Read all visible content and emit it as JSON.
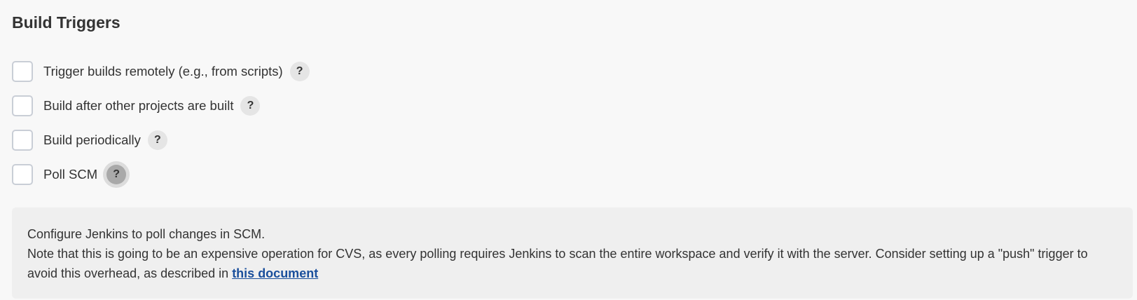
{
  "section": {
    "title": "Build Triggers"
  },
  "triggers": [
    {
      "label": "Trigger builds remotely (e.g., from scripts)",
      "checked": false,
      "help_label": "?"
    },
    {
      "label": "Build after other projects are built",
      "checked": false,
      "help_label": "?"
    },
    {
      "label": "Build periodically",
      "checked": false,
      "help_label": "?"
    },
    {
      "label": "Poll SCM",
      "checked": false,
      "help_label": "?"
    }
  ],
  "help_panel": {
    "line1": "Configure Jenkins to poll changes in SCM.",
    "line2_prefix": "Note that this is going to be an expensive operation for CVS, as every polling requires Jenkins to scan the entire workspace and verify it with the server. Consider setting up a \"push\" trigger to avoid this overhead, as described in ",
    "link_text": "this document"
  },
  "colors": {
    "link": "#1a4f9c",
    "panel_background": "#efefef",
    "page_background": "#f8f8f8"
  }
}
